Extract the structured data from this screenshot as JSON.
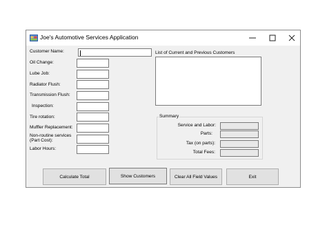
{
  "window": {
    "title": "Joe's Automotive Services  Application",
    "app_icon": "winforms-app-icon",
    "controls": [
      "minimize-icon",
      "maximize-icon",
      "close-icon"
    ]
  },
  "form": {
    "customer_name_label": "Customer Name:",
    "customer_name_value": "",
    "fields": [
      {
        "label": "Oil Change:",
        "value": ""
      },
      {
        "label": "Lube Job:",
        "value": ""
      },
      {
        "label": "Radiator Flush:",
        "value": ""
      },
      {
        "label": "Transmission Flush:",
        "value": ""
      },
      {
        "label": "Inspection:",
        "value": ""
      },
      {
        "label": "Tire rotation:",
        "value": ""
      },
      {
        "label": "Muffler Replacement:",
        "value": ""
      },
      {
        "label": "Non-routine services\n(Part Cost):",
        "value": ""
      },
      {
        "label": "Labor Hours:",
        "value": ""
      }
    ]
  },
  "customers_list": {
    "label": "List of Current and Previous Customers",
    "items": []
  },
  "summary": {
    "group_label": "Summary",
    "rows": [
      {
        "label": "Service and Labor:",
        "value": ""
      },
      {
        "label": "Parts:",
        "value": ""
      },
      {
        "label": "Tax (on parts):",
        "value": ""
      },
      {
        "label": "Total Fees:",
        "value": ""
      }
    ]
  },
  "buttons": {
    "calculate": "Calculate Total",
    "show_customers": "Show Customers",
    "clear": "Clear All Field Values",
    "exit": "Exit"
  }
}
